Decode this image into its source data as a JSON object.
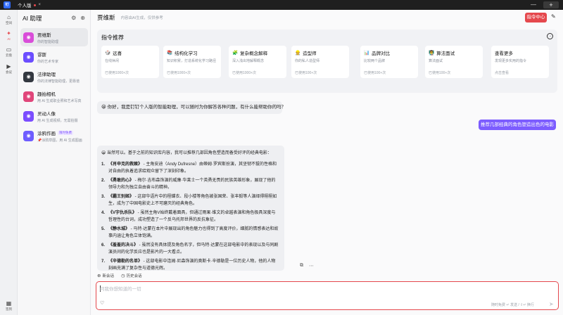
{
  "titlebar": {
    "logo": "钉",
    "tab_label": "个人版",
    "close": "×",
    "plus": "+",
    "minimize": "—"
  },
  "rail": {
    "items": [
      {
        "label": "空间",
        "icon": "space-icon"
      },
      {
        "label": "AI",
        "icon": "ai-icon"
      },
      {
        "label": "云盘",
        "icon": "cloud-drive-icon"
      },
      {
        "label": "会议",
        "icon": "meeting-icon"
      }
    ],
    "bottom": {
      "label": "签到",
      "icon": "calendar-icon"
    }
  },
  "sidebar": {
    "title": "AI 助理",
    "agents": [
      {
        "name": "贾维斯",
        "desc": "你的智能助理",
        "color": "#d94dd9"
      },
      {
        "name": "谬斯",
        "desc": "你的艺术专家",
        "color": "#6b4dff"
      },
      {
        "name": "法律助理",
        "desc": "你的法律智能助理，更靠谱",
        "color": "#333840"
      },
      {
        "name": "趣拍相机",
        "desc": "用 AI 生成职业照和艺术写真",
        "color": "#e0467a"
      },
      {
        "name": "灵动人像",
        "desc": "用 AI 生成视频，无需拍摄",
        "color": "#7b4dff"
      },
      {
        "name": "涂鸦作画",
        "desc": "📌涂鸦草图，用 AI 生成图画",
        "badge": "限时免费",
        "color": "#6e5cff"
      }
    ]
  },
  "header": {
    "title": "贾维斯",
    "subtitle": "内容由AI生成，仅供参考",
    "command_center": "指令中心"
  },
  "recommend": {
    "title": "指令推荐",
    "cards": [
      {
        "icon": "🎲",
        "title": "远喜",
        "desc": "在线休闲",
        "usage": "已使用1000+次"
      },
      {
        "icon": "📚",
        "title": "结构化学习",
        "desc": "知识积累，打造系统化学习路径",
        "usage": "已使用1000+次"
      },
      {
        "icon": "🧩",
        "title": "复杂概念解释",
        "desc": "深入浅出地解释概念",
        "usage": "已使用1000+次"
      },
      {
        "icon": "👷",
        "title": "造型师",
        "desc": "你的私人造型师",
        "usage": "已使用100+次"
      },
      {
        "icon": "📊",
        "title": "品牌对比",
        "desc": "比较两个品牌",
        "usage": "已使用100+次"
      },
      {
        "icon": "👨‍🏫",
        "title": "算法面试",
        "desc": "算法面试",
        "usage": "已使用100+次"
      },
      {
        "icon": "",
        "title": "查看更多",
        "desc": "发现更多实用的指令",
        "usage": "点击查看"
      }
    ]
  },
  "chat": {
    "greeting": "😀 你好，我是钉钉个人版的智能助理，可以随时为你解答各种问题，有什么能帮助你的吗？",
    "user_message": "推荐几部经典的角色塑造出色的电影",
    "answer_intro": "😀 当然可以。基于之前的知识库内容，我可以推荐几部因角色塑造而备受好评的经典电影：",
    "answer_items": [
      {
        "num": "1.",
        "title": "《肖申克的救赎》",
        "text": " - 主角安迪（Andy Dufresne）由蒂姆·罗宾斯扮演，其坚韧不拔的性格和对自由的执着追求给观众留下了深刻印象。"
      },
      {
        "num": "2.",
        "title": "《勇敢的心》",
        "text": " - 梅尔·吉布森饰演的威廉·华莱士一个英勇无畏的民族英雄形象，展现了他的领导力和为独立自由奋斗的精神。"
      },
      {
        "num": "3.",
        "title": "《霸王别姬》",
        "text": " - 这部华语片中的程蝶衣、段小楼等角色被张国荣、张丰毅等人演绎得栩栩如生，成为了中国电影史上不可磨灭的经典角色。"
      },
      {
        "num": "4.",
        "title": "《V字仇杀队》",
        "text": " - 虽然主角V始终戴着面具，但通过雨果·维文的卓越表演和角色极具深度与哲理性的台词，成功塑造了一个反乌托邦世界的反抗象征。"
      },
      {
        "num": "5.",
        "title": "《静水城》",
        "text": " - 马特·达蒙在本片中展现出的角色魅力也得到了高度评价，细腻的情感表达和故事内涵让角色立体饱满。"
      },
      {
        "num": "6.",
        "title": "《羞羞的决斗》",
        "text": " - 虽然没有具体提及角色名字，但马特·达蒙在这部电影中的表现以及与同剧演员间的化学反应也是影片的一大看点。"
      },
      {
        "num": "7.",
        "title": "《辛德勒的名单》",
        "text": " - 这部电影中连姆·尼森饰演的奥斯卡·辛德勒是一位历史人物，他的人物刻画充满了复杂性与道德光辉。"
      }
    ]
  },
  "actions": {
    "new_chat": "新会话",
    "history": "历史会话"
  },
  "input": {
    "placeholder": "问我你想知道的一切",
    "hint": "随时免费    ↵ 发送 / ⇧↵ 换行"
  }
}
